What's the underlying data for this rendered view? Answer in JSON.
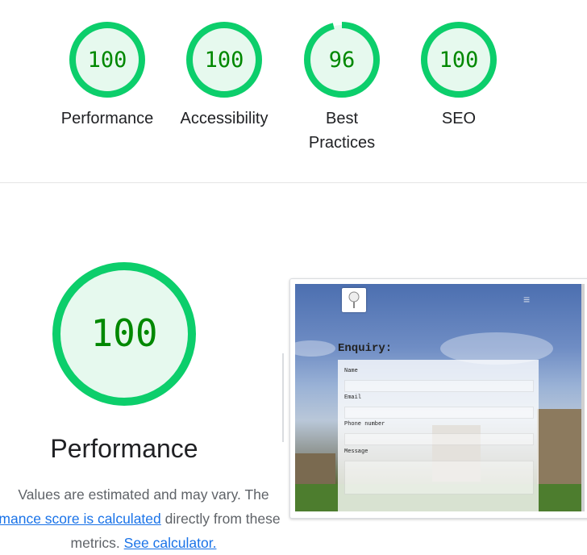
{
  "summary": [
    {
      "score": "100",
      "label": "Performance",
      "fraction": 1.0
    },
    {
      "score": "100",
      "label": "Accessibility",
      "fraction": 1.0
    },
    {
      "score": "96",
      "label": "Best Practices",
      "fraction": 0.96
    },
    {
      "score": "100",
      "label": "SEO",
      "fraction": 1.0
    }
  ],
  "performance": {
    "score": "100",
    "fraction": 1.0,
    "title": "Performance",
    "desc_prefix": "Values are estimated and may vary. The",
    "desc_link": "mance score is calculated",
    "desc_middle": " directly from these",
    "desc_suffix": "metrics. ",
    "desc_link2": "See calculator."
  },
  "screenshot": {
    "heading": "Enquiry:",
    "fields": [
      "Name",
      "Email",
      "Phone number",
      "Message"
    ],
    "menu_glyph": "≡"
  },
  "colors": {
    "pass_stroke": "#0cce6b",
    "pass_fill": "#e6f9ee",
    "pass_text": "#008800"
  }
}
